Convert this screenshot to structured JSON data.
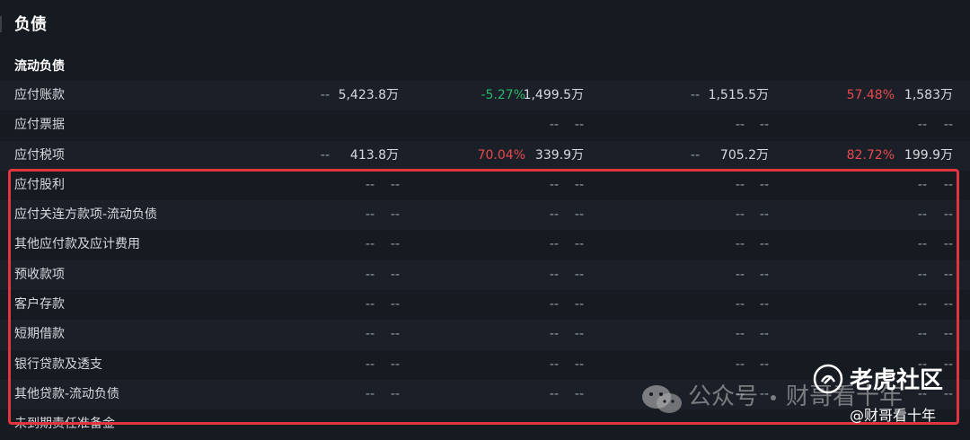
{
  "section": {
    "title": "负债"
  },
  "subsection": {
    "title": "流动负债"
  },
  "rows": [
    {
      "label": "应付账款",
      "c1": "--",
      "c2": "5,423.8万",
      "c3": "-5.27%",
      "c4": "1,499.5万",
      "c5": "--",
      "c6": "1,515.5万",
      "c7": "57.48%",
      "c8": "1,583万"
    },
    {
      "label": "应付票据",
      "c1": "",
      "c2": "",
      "c3": "--",
      "c4": "--",
      "c5": "--",
      "c6": "--",
      "c7": "--",
      "c8": "--"
    },
    {
      "label": "应付税项",
      "c1": "--",
      "c2": "413.8万",
      "c3": "70.04%",
      "c4": "339.9万",
      "c5": "--",
      "c6": "705.2万",
      "c7": "82.72%",
      "c8": "199.9万"
    },
    {
      "label": "应付股利",
      "c1": "--",
      "c2": "--",
      "c3": "--",
      "c4": "--",
      "c5": "--",
      "c6": "--",
      "c7": "--",
      "c8": "--"
    },
    {
      "label": "应付关连方款项-流动负债",
      "c1": "--",
      "c2": "--",
      "c3": "--",
      "c4": "--",
      "c5": "--",
      "c6": "--",
      "c7": "--",
      "c8": "--"
    },
    {
      "label": "其他应付款及应计费用",
      "c1": "--",
      "c2": "--",
      "c3": "--",
      "c4": "--",
      "c5": "--",
      "c6": "--",
      "c7": "--",
      "c8": "--"
    },
    {
      "label": "预收款项",
      "c1": "--",
      "c2": "--",
      "c3": "--",
      "c4": "--",
      "c5": "--",
      "c6": "--",
      "c7": "--",
      "c8": "--"
    },
    {
      "label": "客户存款",
      "c1": "--",
      "c2": "--",
      "c3": "--",
      "c4": "--",
      "c5": "--",
      "c6": "--",
      "c7": "--",
      "c8": "--"
    },
    {
      "label": "短期借款",
      "c1": "--",
      "c2": "--",
      "c3": "--",
      "c4": "--",
      "c5": "--",
      "c6": "--",
      "c7": "--",
      "c8": "--"
    },
    {
      "label": "银行贷款及透支",
      "c1": "--",
      "c2": "--",
      "c3": "--",
      "c4": "--",
      "c5": "--",
      "c6": "--",
      "c7": "--",
      "c8": "--"
    },
    {
      "label": "其他贷款-流动负债",
      "c1": "--",
      "c2": "--",
      "c3": "--",
      "c4": "--",
      "c5": "--",
      "c6": "--",
      "c7": "--",
      "c8": "--"
    },
    {
      "label": "未到期责任准备金",
      "c1": "",
      "c2": "",
      "c3": "",
      "c4": "",
      "c5": "",
      "c6": "",
      "c7": "",
      "c8": ""
    }
  ],
  "watermark": {
    "wechat_text": "公众号",
    "account_text": "财哥看十年",
    "logo_text": "老虎社区",
    "handle_text": "@财哥看十年"
  },
  "colors": {
    "up": "#e8484d",
    "down": "#2db56a",
    "highlight_border": "#e0343e"
  },
  "icons": {
    "wechat": "wechat-icon",
    "tiger": "tiger-logo-icon"
  }
}
